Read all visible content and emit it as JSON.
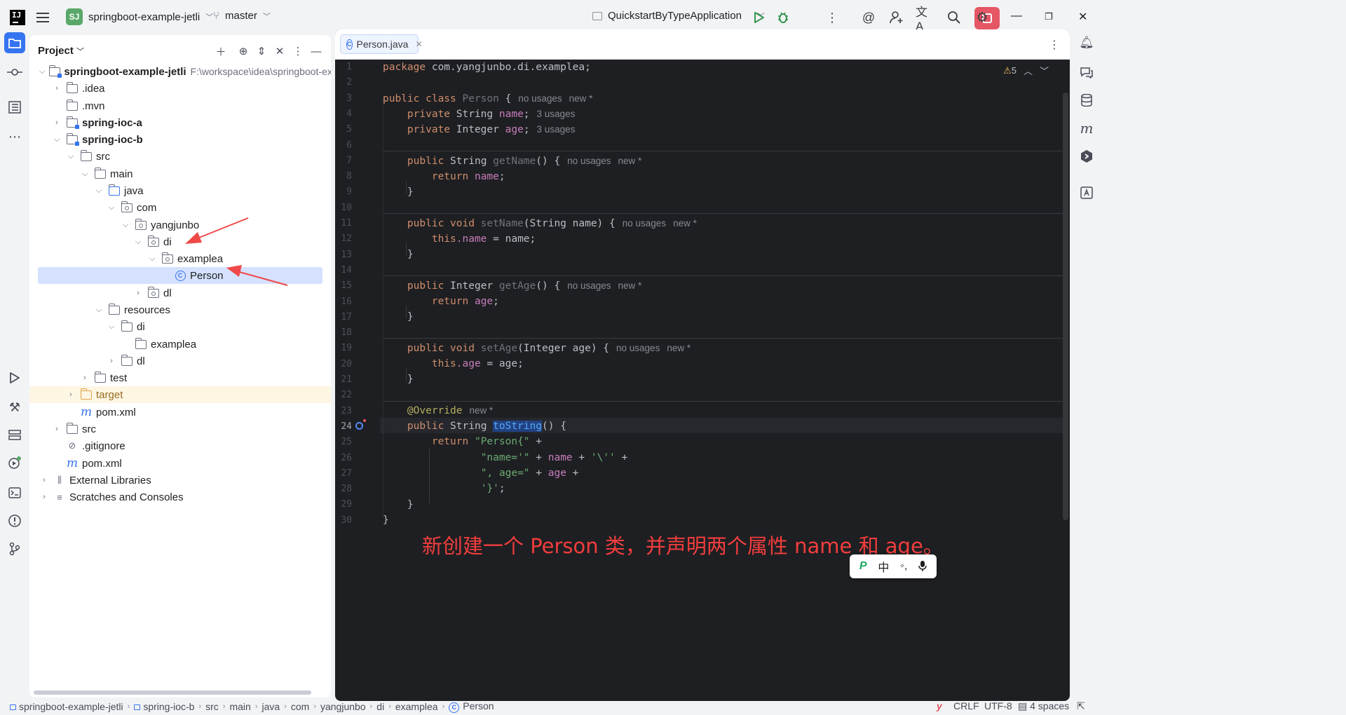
{
  "titlebar": {
    "project_badge": "SJ",
    "project_name": "springboot-example-jetli",
    "branch": "master",
    "run_config": "QuickstartByTypeApplication"
  },
  "project_panel": {
    "title": "Project",
    "tree": [
      {
        "label": "springboot-example-jetli",
        "path": "F:\\workspace\\idea\\springboot-example-je"
      },
      {
        "label": ".idea"
      },
      {
        "label": ".mvn"
      },
      {
        "label": "spring-ioc-a"
      },
      {
        "label": "spring-ioc-b"
      },
      {
        "label": "src"
      },
      {
        "label": "main"
      },
      {
        "label": "java"
      },
      {
        "label": "com"
      },
      {
        "label": "yangjunbo"
      },
      {
        "label": "di"
      },
      {
        "label": "examplea"
      },
      {
        "label": "Person"
      },
      {
        "label": "dl"
      },
      {
        "label": "resources"
      },
      {
        "label": "di"
      },
      {
        "label": "examplea"
      },
      {
        "label": "dl"
      },
      {
        "label": "test"
      },
      {
        "label": "target"
      },
      {
        "label": "pom.xml"
      },
      {
        "label": "src"
      },
      {
        "label": ".gitignore"
      },
      {
        "label": "pom.xml"
      },
      {
        "label": "External Libraries"
      },
      {
        "label": "Scratches and Consoles"
      }
    ]
  },
  "editor": {
    "tab_label": "Person.java",
    "warning_count": "5",
    "line_numbers": [
      "1",
      "2",
      "3",
      "4",
      "5",
      "6",
      "7",
      "8",
      "9",
      "10",
      "11",
      "12",
      "13",
      "14",
      "15",
      "16",
      "17",
      "18",
      "19",
      "20",
      "21",
      "22",
      "23",
      "24",
      "25",
      "26",
      "27",
      "28",
      "29",
      "30"
    ],
    "code": {
      "l1_kw": "package",
      "l1_rest": " com.yangjunbo.di.examplea;",
      "l3_kw": "public class",
      "l3_name": " Person",
      "l3_rest": " {",
      "l3_hint1": "no usages",
      "l3_hint2": "new *",
      "l4_kw": "private",
      "l4_type": " String ",
      "l4_field": "name",
      "l4_rest": ";",
      "l4_hint": "3 usages",
      "l5_kw": "private",
      "l5_type": " Integer ",
      "l5_field": "age",
      "l5_rest": ";",
      "l5_hint": "3 usages",
      "l7_kw": "public",
      "l7_type": " String ",
      "l7_fn": "getName",
      "l7_rest": "() {",
      "l7_hint1": "no usages",
      "l7_hint2": "new *",
      "l8_kw": "return",
      "l8_field": " name",
      "l8_rest": ";",
      "close": "}",
      "l11_kw": "public void",
      "l11_fn": " setName",
      "l11_rest": "(String name) {",
      "l11_hint1": "no usages",
      "l11_hint2": "new *",
      "l12_kw": "this",
      "l12_field": ".name",
      "l12_rest": " = name;",
      "l15_kw": "public",
      "l15_type": " Integer ",
      "l15_fn": "getAge",
      "l15_rest": "() {",
      "l15_hint1": "no usages",
      "l15_hint2": "new *",
      "l16_kw": "return",
      "l16_field": " age",
      "l16_rest": ";",
      "l19_kw": "public void",
      "l19_fn": " setAge",
      "l19_rest": "(Integer age) {",
      "l19_hint1": "no usages",
      "l19_hint2": "new *",
      "l20_kw": "this",
      "l20_field": ".age",
      "l20_rest": " = age;",
      "l23_ann": "@Override",
      "l23_hint": "new *",
      "l24_kw": "public",
      "l24_type": " String ",
      "l24_fn": "toString",
      "l24_rest": "() {",
      "l25_kw": "return",
      "l25_str": " \"Person{\"",
      "l25_rest": " +",
      "l26_str": "\"name='\"",
      "l26_a": " + ",
      "l26_field": "name",
      "l26_b": " + ",
      "l26_str2": "'\\''",
      "l26_rest": " +",
      "l27_str": "\", age=\"",
      "l27_a": " + ",
      "l27_field": "age",
      "l27_rest": " +",
      "l28_str": "'}'",
      "l28_rest": ";"
    },
    "annotation": "新创建一个 Person 类，并声明两个属性 name 和 age。"
  },
  "statusbar": {
    "breadcrumbs": [
      "springboot-example-jetli",
      "spring-ioc-b",
      "src",
      "main",
      "java",
      "com",
      "yangjunbo",
      "di",
      "examplea",
      "Person"
    ],
    "line_sep": "CRLF",
    "encoding": "UTF-8",
    "indent": "4 spaces"
  },
  "ime": {
    "p": "P",
    "lang": "中",
    "punct": "◦,",
    "mic": "🎤"
  },
  "colors": {
    "accent": "#3574f0",
    "stop": "#e55765",
    "annotation": "#f23d3d"
  }
}
